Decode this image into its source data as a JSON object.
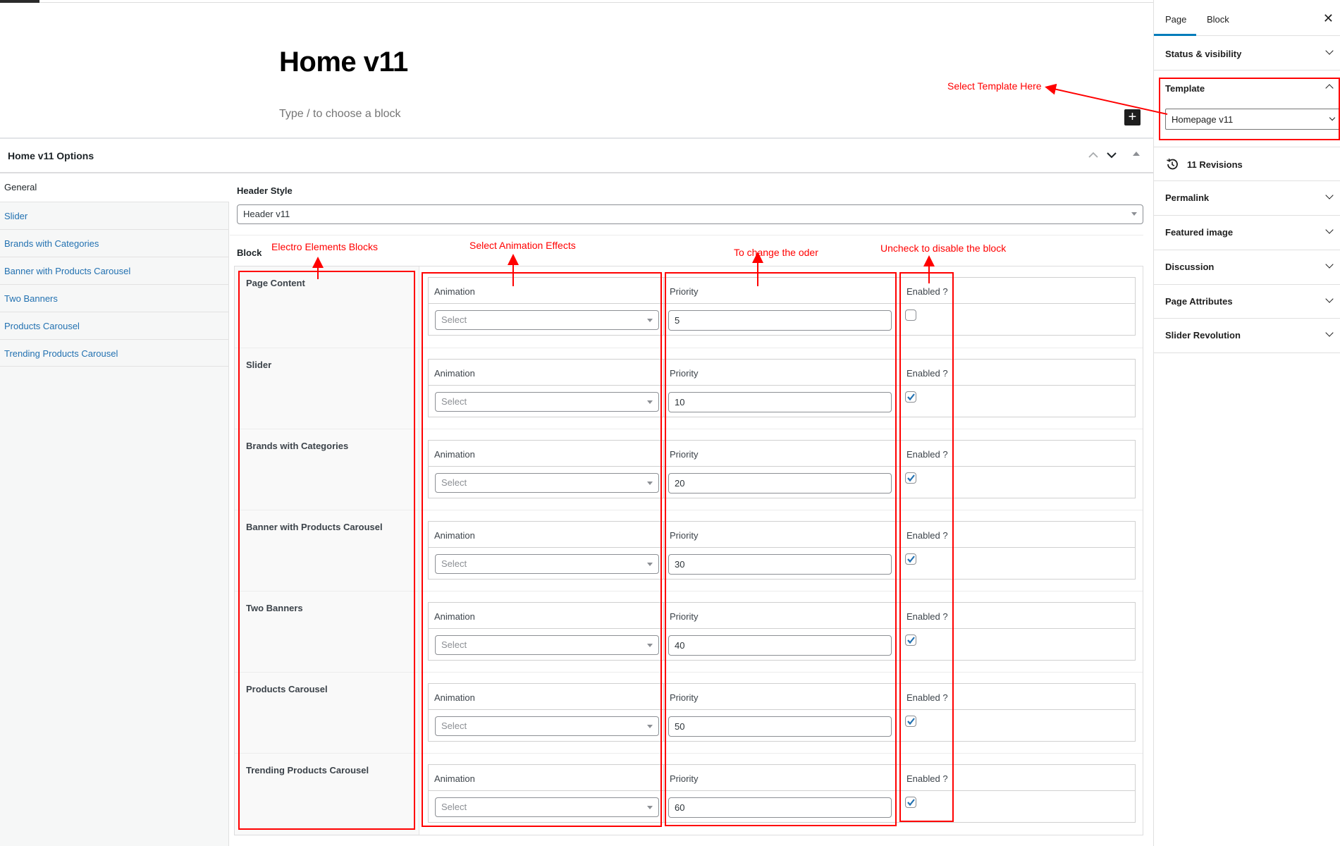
{
  "editor": {
    "post_title": "Home v11",
    "block_placeholder": "Type / to choose a block",
    "inserter_icon": "plus-icon"
  },
  "metabox": {
    "title": "Home v11 Options",
    "controls": [
      "chevron-up-icon",
      "chevron-down-icon",
      "triangle-up-icon"
    ]
  },
  "nav": {
    "active": "General",
    "items": [
      "Slider",
      "Brands with Categories",
      "Banner with Products Carousel",
      "Two Banners",
      "Products Carousel",
      "Trending Products Carousel"
    ]
  },
  "general": {
    "header_style_label": "Header Style",
    "header_style_value": "Header v11",
    "block_label": "Block",
    "column_labels": {
      "animation": "Animation",
      "priority": "Priority",
      "enabled": "Enabled ?"
    },
    "select_placeholder": "Select",
    "blocks": [
      {
        "name": "Page Content",
        "priority": "5",
        "enabled": false
      },
      {
        "name": "Slider",
        "priority": "10",
        "enabled": true
      },
      {
        "name": "Brands with Categories",
        "priority": "20",
        "enabled": true
      },
      {
        "name": "Banner with Products Carousel",
        "priority": "30",
        "enabled": true
      },
      {
        "name": "Two Banners",
        "priority": "40",
        "enabled": true
      },
      {
        "name": "Products Carousel",
        "priority": "50",
        "enabled": true
      },
      {
        "name": "Trending Products Carousel",
        "priority": "60",
        "enabled": true
      }
    ]
  },
  "sidebar": {
    "tabs": [
      "Page",
      "Block"
    ],
    "active_tab": "Page",
    "close_icon": "close-icon",
    "panels": {
      "status": "Status & visibility",
      "template": "Template",
      "template_value": "Homepage v11",
      "revisions": "11 Revisions",
      "permalink": "Permalink",
      "featured_image": "Featured image",
      "discussion": "Discussion",
      "page_attributes": "Page Attributes",
      "slider_revolution": "Slider Revolution"
    }
  },
  "annotations": {
    "select_template": "Select Template Here",
    "electro_blocks": "Electro Elements Blocks",
    "animation_effects": "Select Animation Effects",
    "change_order": "To change the oder",
    "disable_block": "Uncheck to disable the block",
    "color": "#ff0000"
  }
}
